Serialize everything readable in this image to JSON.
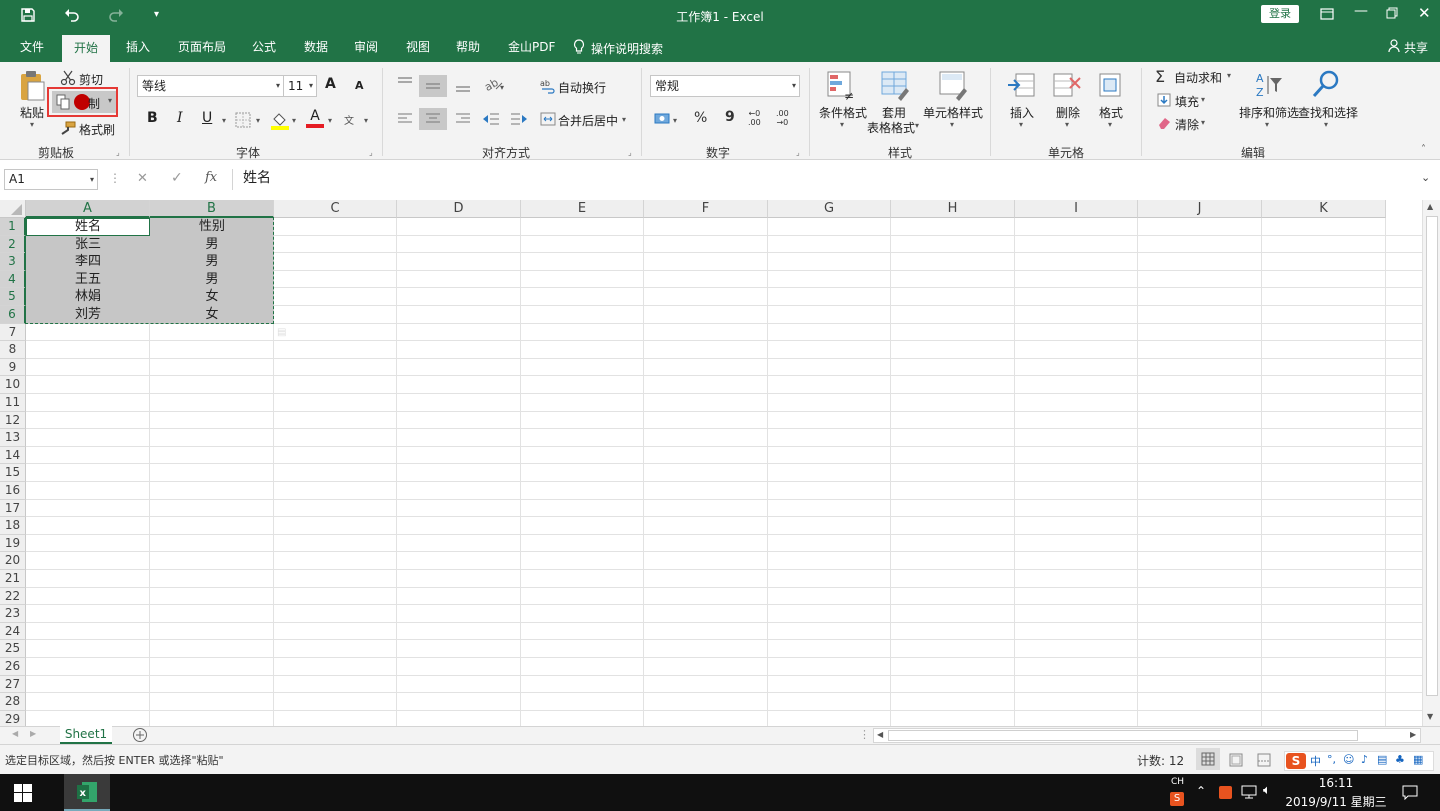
{
  "window": {
    "title": "工作簿1 - Excel",
    "login_label": "登录",
    "quick_access": [
      "save-icon",
      "undo-icon",
      "redo-icon",
      "customize-icon"
    ]
  },
  "tabs": [
    "文件",
    "开始",
    "插入",
    "页面布局",
    "公式",
    "数据",
    "审阅",
    "视图",
    "帮助",
    "金山PDF"
  ],
  "active_tab": "开始",
  "tell_me": "操作说明搜索",
  "share": "共享",
  "clipboard": {
    "paste": "粘贴",
    "cut": "剪切",
    "copy": "复制",
    "copy_visible": "制",
    "format_painter": "格式刷",
    "group": "剪贴板"
  },
  "font": {
    "name": "等线",
    "size": "11",
    "bold": "B",
    "italic": "I",
    "underline": "U",
    "grow": "A",
    "shrink": "A",
    "font_color": "A",
    "phonetic": "文",
    "group": "字体",
    "highlight_color": "#ffff00",
    "text_color": "#e51c23"
  },
  "alignment": {
    "wrap_text": "自动换行",
    "merge_center": "合并后居中",
    "group": "对齐方式"
  },
  "number": {
    "format": "常规",
    "percent": "%",
    "comma": "9",
    "inc_decimal_top": "←0",
    "inc_decimal_bottom": ".00",
    "dec_decimal_top": ".00",
    "dec_decimal_bottom": "→0",
    "group": "数字"
  },
  "styles": {
    "conditional": "条件格式",
    "table_format_1": "套用",
    "table_format_2": "表格格式",
    "cell_styles": "单元格样式",
    "group": "样式"
  },
  "cells": {
    "insert": "插入",
    "delete": "删除",
    "format": "格式",
    "group": "单元格"
  },
  "editing": {
    "autosum": "自动求和",
    "fill": "填充",
    "clear": "清除",
    "sort_filter": "排序和筛选",
    "find_select": "查找和选择",
    "group": "编辑"
  },
  "formula_bar": {
    "name_box": "A1",
    "cancel": "✕",
    "enter": "✓",
    "fx": "fx",
    "content": "姓名"
  },
  "columns": [
    "A",
    "B",
    "C",
    "D",
    "E",
    "F",
    "G",
    "H",
    "I",
    "J",
    "K"
  ],
  "rows": [
    "1",
    "2",
    "3",
    "4",
    "5",
    "6",
    "7",
    "8",
    "9",
    "10",
    "11",
    "12",
    "13",
    "14",
    "15",
    "16",
    "17",
    "18",
    "19",
    "20",
    "21",
    "22",
    "23",
    "24",
    "25",
    "26",
    "27",
    "28",
    "29"
  ],
  "table": [
    [
      "姓名",
      "性别"
    ],
    [
      "张三",
      "男"
    ],
    [
      "李四",
      "男"
    ],
    [
      "王五",
      "男"
    ],
    [
      "林娟",
      "女"
    ],
    [
      "刘芳",
      "女"
    ]
  ],
  "sheet_tab": "Sheet1",
  "status": {
    "message": "选定目标区域，然后按 ENTER 或选择\"粘贴\"",
    "count": "计数: 12"
  },
  "taskbar": {
    "ime_lang": "CH",
    "time": "16:11",
    "date": "2019/9/11 星期三",
    "ime_mode": "中"
  },
  "colors": {
    "accent": "#217346",
    "selection_fill": "#c6c6c6",
    "highlight_box": "#e53935",
    "cursor_dot": "#c00000"
  }
}
